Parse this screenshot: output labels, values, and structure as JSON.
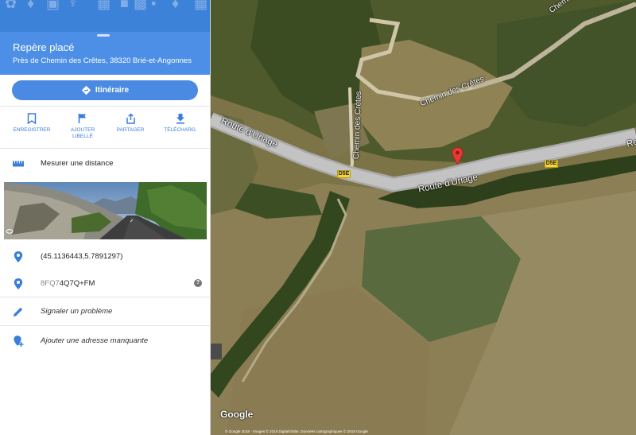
{
  "panel": {
    "title": "Repère placé",
    "address": "Près de Chemin des Crêtes, 38320 Brié-et-Angonnes",
    "route_button": "Itinéraire",
    "actions": [
      {
        "label_line1": "ENREGISTRER",
        "label_line2": "",
        "icon": "bookmark-icon"
      },
      {
        "label_line1": "AJOUTER",
        "label_line2": "LIBELLÉ",
        "icon": "flag-icon"
      },
      {
        "label_line1": "PARTAGER",
        "label_line2": "",
        "icon": "share-icon"
      },
      {
        "label_line1": "TÉLÉCHARG.",
        "label_line2": "",
        "icon": "download-icon"
      }
    ],
    "measure_label": "Mesurer une distance",
    "coordinates": "(45.1136443,5.7891297)",
    "plus_code_prefix": "8FQ7",
    "plus_code_main": "4Q7Q+FM",
    "report_problem": "Signaler un problème",
    "add_missing_address": "Ajouter une adresse manquante"
  },
  "map": {
    "road_labels": {
      "route_uriage_left": "Route d'Uriage",
      "route_uriage_center": "Route d'Uriage",
      "route_uriage_right": "Ro",
      "chemin_cretes_top": "Chemin des",
      "chemin_cretes_middle": "Chemin des Crêtes",
      "chemin_cretes_vertical": "Chemin des Crêtes"
    },
    "road_shields": [
      "D5E",
      "D5E"
    ],
    "google_logo": "Google",
    "attribution": "© Google 2018 · Images © 2018 DigitalGlobe, Données cartographiques © 2018 Google"
  },
  "colors": {
    "accent": "#4d8fe6",
    "button": "#4a8ae2",
    "pin": "#e53935",
    "shield": "#f4d43a"
  }
}
